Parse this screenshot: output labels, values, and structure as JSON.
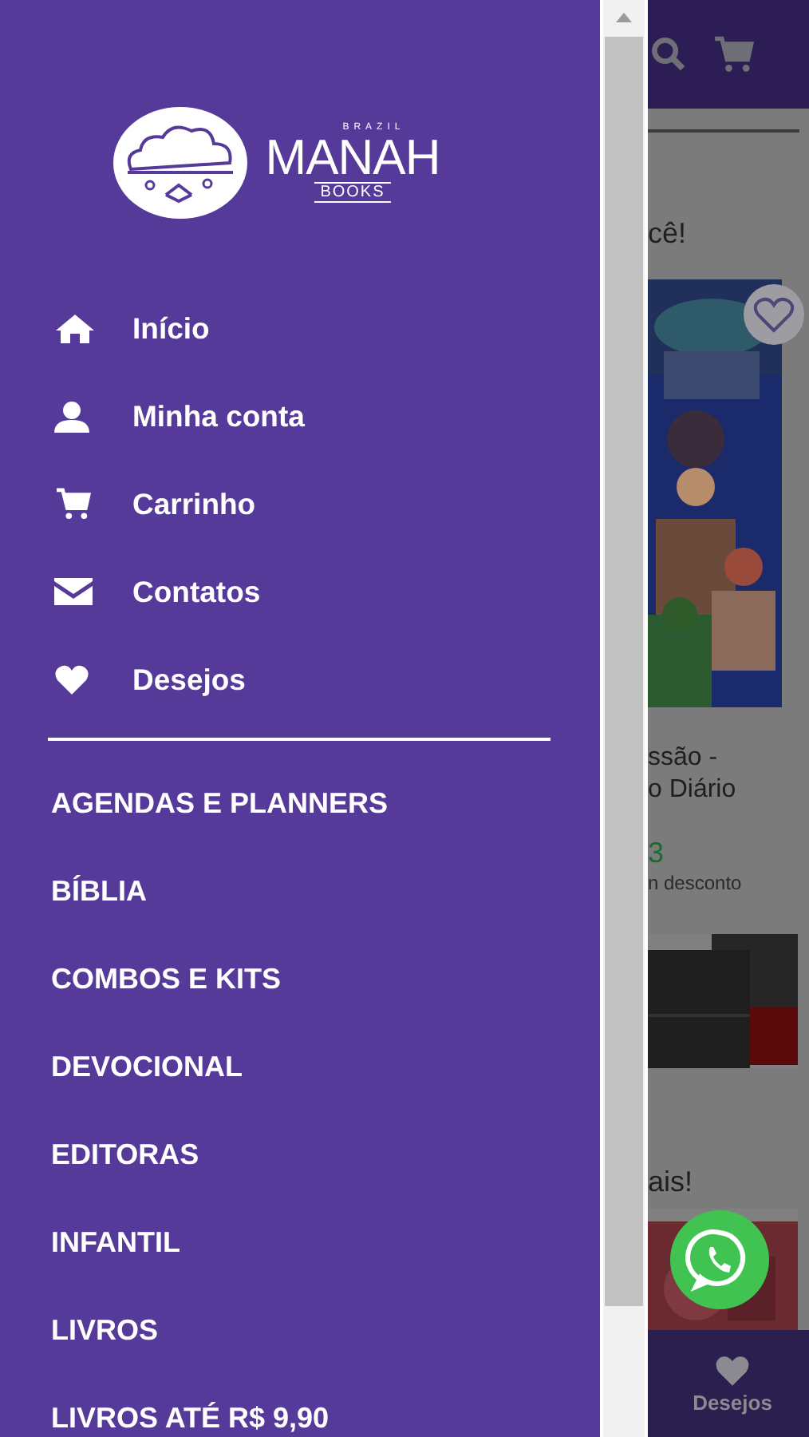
{
  "logo": {
    "tagline_top": "BRAZIL",
    "name": "MANAH",
    "tagline_bottom": "BOOKS"
  },
  "menu": [
    {
      "kind": "home",
      "label": "Início"
    },
    {
      "kind": "user",
      "label": "Minha conta"
    },
    {
      "kind": "cart",
      "label": "Carrinho"
    },
    {
      "kind": "mail",
      "label": "Contatos"
    },
    {
      "kind": "heart",
      "label": "Desejos"
    }
  ],
  "categories": [
    "AGENDAS E PLANNERS",
    "BÍBLIA",
    "COMBOS E KITS",
    "DEVOCIONAL",
    "EDITORAS",
    "INFANTIL",
    "LIVROS",
    "LIVROS ATÉ R$ 9,90"
  ],
  "backdrop": {
    "section_titles": [
      "cê!",
      "ais!"
    ],
    "product": {
      "title_lines": [
        "ssão -",
        "o Diário"
      ],
      "price": "3",
      "note": "n desconto"
    },
    "bottom_tab": {
      "label": "Desejos"
    }
  }
}
